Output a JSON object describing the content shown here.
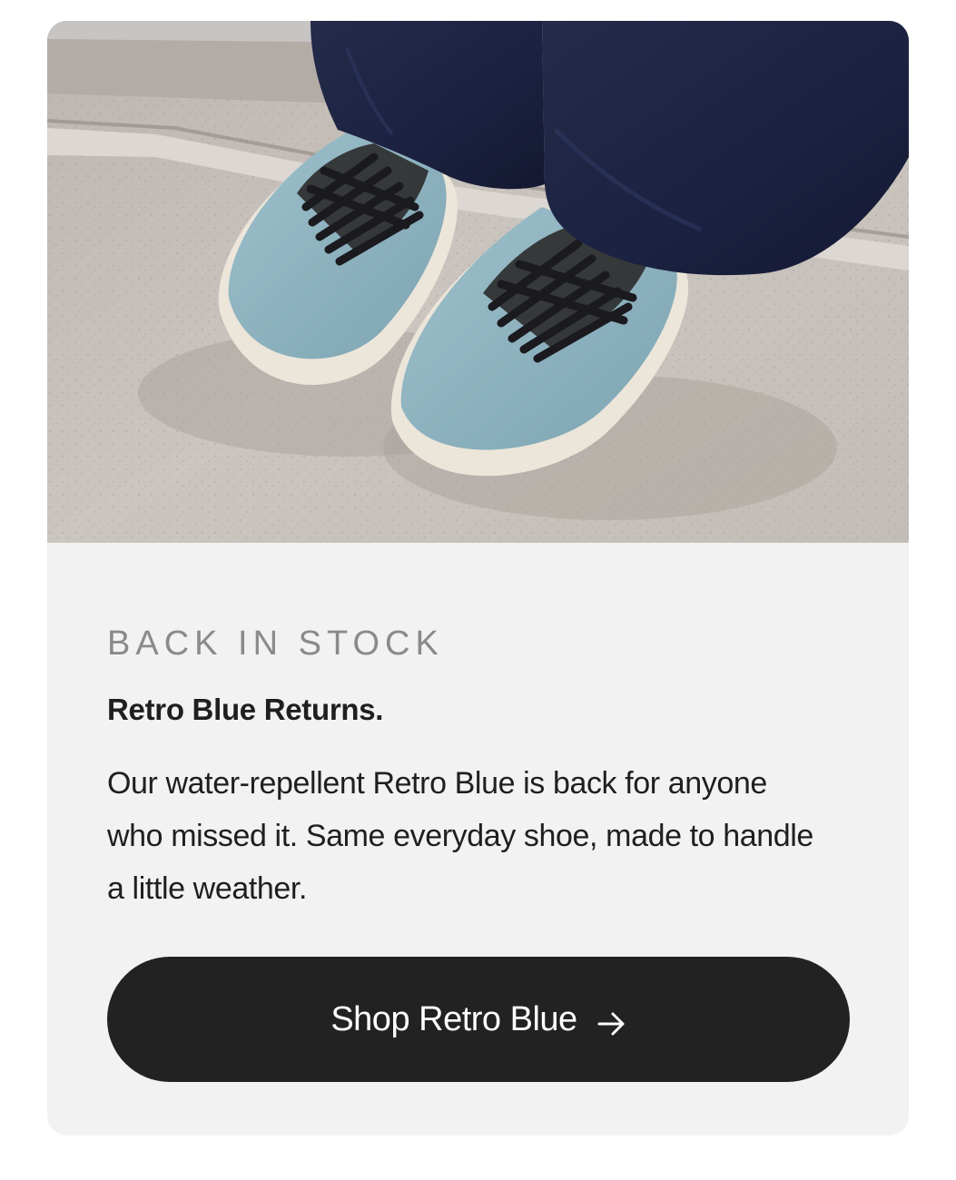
{
  "card": {
    "image_alt": "Retro Blue shoes",
    "eyebrow": "BACK IN STOCK",
    "headline": "Retro Blue Returns.",
    "body": "Our water-repellent Retro Blue is back for anyone who missed it. Same everyday shoe, made to handle a little weather.",
    "cta": {
      "label": "Shop Retro Blue",
      "icon": "arrow-right-icon"
    }
  },
  "colors": {
    "card_background": "#f2f2f2",
    "eyebrow_text": "#8a8a8a",
    "button_background": "#222222",
    "button_text": "#ffffff",
    "shoe_blue": "#8fb3c0",
    "denim": "#1d2440"
  }
}
